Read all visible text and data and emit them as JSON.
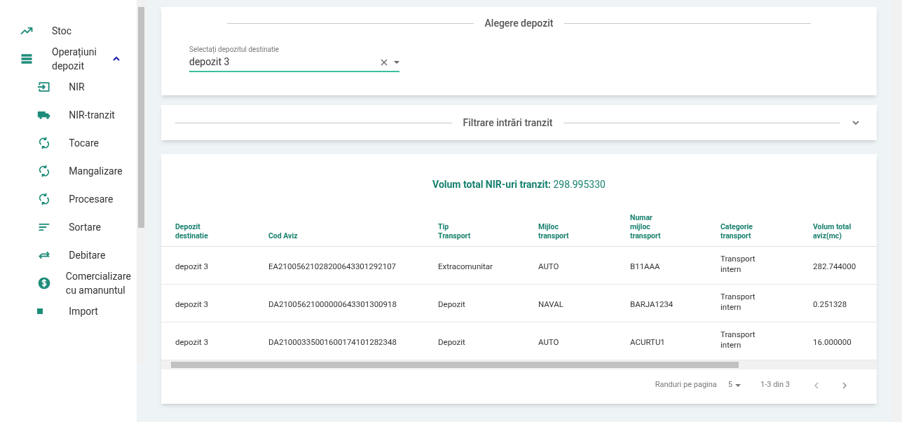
{
  "sidebar": {
    "items": [
      {
        "label": "Stoc"
      },
      {
        "label": "Operațiuni depozit",
        "expanded": true,
        "children": [
          {
            "label": "NIR"
          },
          {
            "label": "NIR-tranzit"
          },
          {
            "label": "Tocare"
          },
          {
            "label": "Mangalizare"
          },
          {
            "label": "Procesare"
          },
          {
            "label": "Sortare"
          },
          {
            "label": "Debitare"
          },
          {
            "label": "Comercializare cu amanuntul"
          },
          {
            "label": "Import"
          }
        ]
      }
    ]
  },
  "depot_section": {
    "title": "Alegere depozit",
    "field_label": "Selectați depozitul destinatie",
    "value": "depozit 3"
  },
  "filter_section": {
    "title": "Filtrare intrări tranzit",
    "expanded": false
  },
  "summary": "**Volum total NIR-uri tranzit:** 298.995330",
  "table": {
    "columns": [
      "Depozit destinatie",
      "Cod Aviz",
      "Tip Transport",
      "Mijloc transport",
      "Numar mijloc transport",
      "Categorie transport",
      "Volum total aviz(mc)"
    ],
    "rows": [
      [
        "depozit 3",
        "EA21005621028200643301292107",
        "Extracomunitar",
        "AUTO",
        "B11AAA",
        "Transport intern",
        "282.744000"
      ],
      [
        "depozit 3",
        "DA21005621000000643301300918",
        "Depozit",
        "NAVAL",
        "BARJA1234",
        "Transport intern",
        "0.251328"
      ],
      [
        "depozit 3",
        "DA21000335001600174101282348",
        "Depozit",
        "AUTO",
        "ACURTU1",
        "Transport intern",
        "16.000000"
      ]
    ]
  },
  "pagination": {
    "rows_per_page_label": "Randuri pe pagina",
    "rows_per_page": "5",
    "range": "1-3 din 3"
  }
}
